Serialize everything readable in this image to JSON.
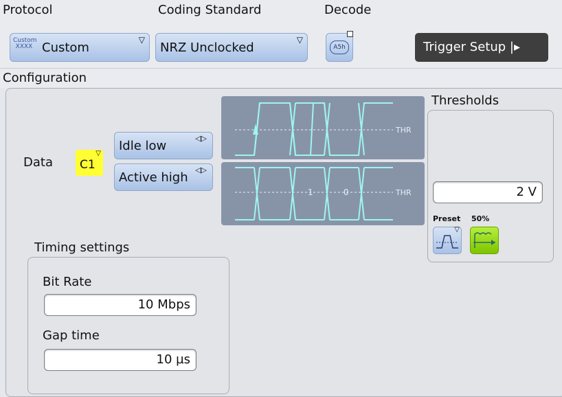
{
  "protocol": {
    "label": "Protocol",
    "value": "Custom",
    "icon_text_top": "Custom",
    "icon_text_bottom": "XXXX"
  },
  "coding": {
    "label": "Coding Standard",
    "value": "NRZ Unclocked"
  },
  "decode": {
    "label": "Decode",
    "icon_text": "A5h"
  },
  "trigger_setup": {
    "label": "Trigger Setup |▸"
  },
  "configuration": {
    "header": "Configuration"
  },
  "data": {
    "label": "Data",
    "channel": "C1",
    "idle_label": "Idle low",
    "active_label": "Active high",
    "waveform_labels": {
      "thr": "THR",
      "bit1": "1",
      "bit0": "0"
    }
  },
  "thresholds": {
    "label": "Thresholds",
    "value": "2 V",
    "preset_label": "Preset",
    "percent_label": "50%"
  },
  "timing": {
    "title": "Timing settings",
    "bit_rate_label": "Bit Rate",
    "bit_rate_value": "10 Mbps",
    "gap_label": "Gap time",
    "gap_value": "10 µs"
  },
  "colors": {
    "accent_blue": "#a9c2e6",
    "channel_yellow": "#ffff33",
    "waveform_bg": "#8794a8",
    "waveform_line": "#9ff5ee",
    "preset_green": "#8fd400"
  }
}
